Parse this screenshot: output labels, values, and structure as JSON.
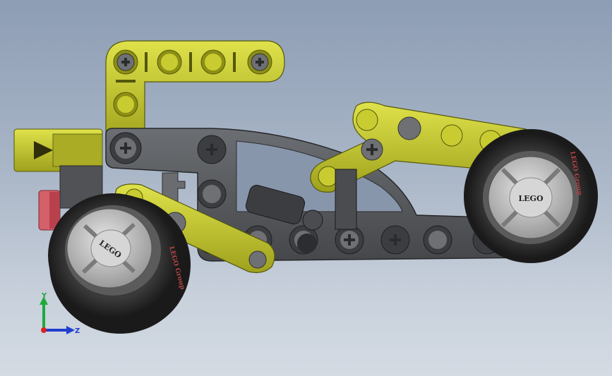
{
  "viewport": {
    "background_top": "#8d9db4",
    "background_bottom": "#d4dbe3"
  },
  "model": {
    "beam_color": "#c6c92b",
    "frame_color": "#5b5d60",
    "hub_color": "#c9c9c9",
    "tire_color": "#2a2a2a",
    "accent_red": "#d4606a",
    "left_wheel": {
      "hub_text": "LEGO",
      "side_text": "LEGO Group"
    },
    "right_wheel": {
      "hub_text": "LEGO",
      "side_text": "LEGO Group"
    }
  },
  "triad": {
    "y_label": "Y",
    "z_label": "Z",
    "y_color": "#1faa3a",
    "z_color": "#1f3fcf",
    "origin_color": "#d22"
  }
}
